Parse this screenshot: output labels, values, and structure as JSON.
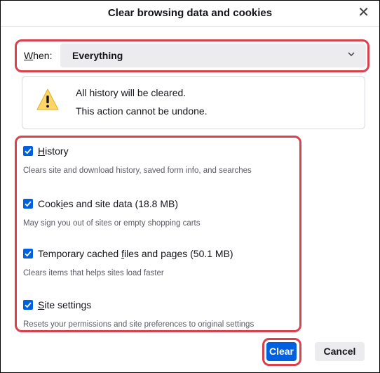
{
  "dialog": {
    "title": "Clear browsing data and cookies",
    "close_glyph": "✕",
    "close_icon": "close-icon"
  },
  "when": {
    "label_accesskey": "W",
    "label_rest": "hen:",
    "selected_value": "Everything",
    "chevron_icon": "chevron-down-icon"
  },
  "warning": {
    "icon": "warning-triangle-icon",
    "line1": "All history will be cleared.",
    "line2": "This action cannot be undone."
  },
  "options": [
    {
      "checked": true,
      "label_pre": "",
      "label_key": "H",
      "label_post": "istory",
      "description": "Clears site and download history, saved form info, and searches"
    },
    {
      "checked": true,
      "label_pre": "Cook",
      "label_key": "i",
      "label_post": "es and site data (18.8 MB)",
      "description": "May sign you out of sites or empty shopping carts"
    },
    {
      "checked": true,
      "label_pre": "Temporary cached ",
      "label_key": "f",
      "label_post": "iles and pages (50.1 MB)",
      "description": "Clears items that helps sites load faster"
    },
    {
      "checked": true,
      "label_pre": "",
      "label_key": "S",
      "label_post": "ite settings",
      "description": "Resets your permissions and site preferences to original settings"
    }
  ],
  "buttons": {
    "clear": "Clear",
    "cancel": "Cancel"
  },
  "colors": {
    "accent": "#0061e0",
    "highlight": "#d9414f",
    "warning": "#ffd567"
  }
}
